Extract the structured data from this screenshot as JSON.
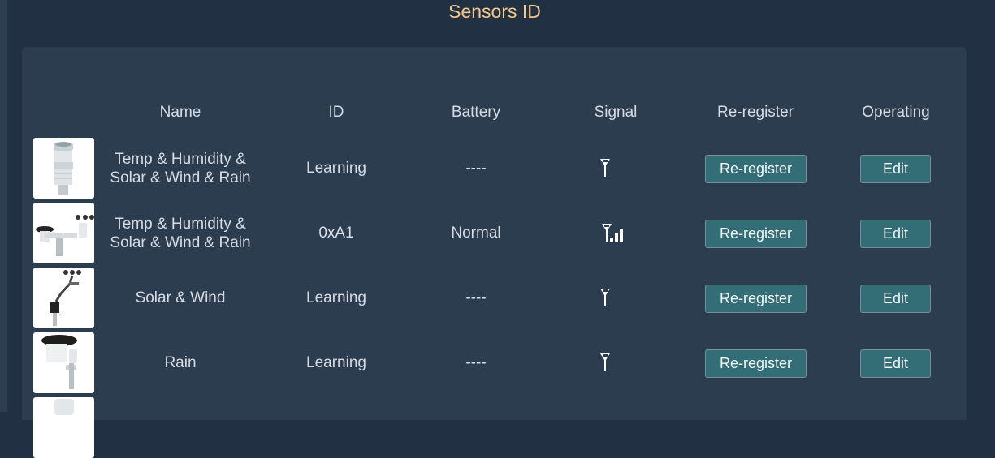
{
  "title": "Sensors ID",
  "columns": [
    "Name",
    "ID",
    "Battery",
    "Signal",
    "Re-register",
    "Operating"
  ],
  "rows": [
    {
      "image": "temp-humidity-sensor-image",
      "name_line1": "Temp & Humidity &",
      "name_line2": "Solar & Wind & Rain",
      "id": "Learning",
      "battery": "----",
      "signal": "searching",
      "reregister_label": "Re-register",
      "edit_label": "Edit"
    },
    {
      "image": "7-in-1-weather-station-image",
      "name_line1": "Temp & Humidity &",
      "name_line2": "Solar & Wind & Rain",
      "id": "0xA1",
      "battery": "Normal",
      "signal": "3-bars",
      "reregister_label": "Re-register",
      "edit_label": "Edit"
    },
    {
      "image": "solar-wind-sensor-image",
      "name_line1": "Solar & Wind",
      "name_line2": "",
      "id": "Learning",
      "battery": "----",
      "signal": "searching",
      "reregister_label": "Re-register",
      "edit_label": "Edit"
    },
    {
      "image": "rain-gauge-image",
      "name_line1": "Rain",
      "name_line2": "",
      "id": "Learning",
      "battery": "----",
      "signal": "searching",
      "reregister_label": "Re-register",
      "edit_label": "Edit"
    }
  ],
  "colors": {
    "title": "#f5c88a",
    "button": "#336e77",
    "panel": "#2d3d50",
    "background": "#213143"
  }
}
